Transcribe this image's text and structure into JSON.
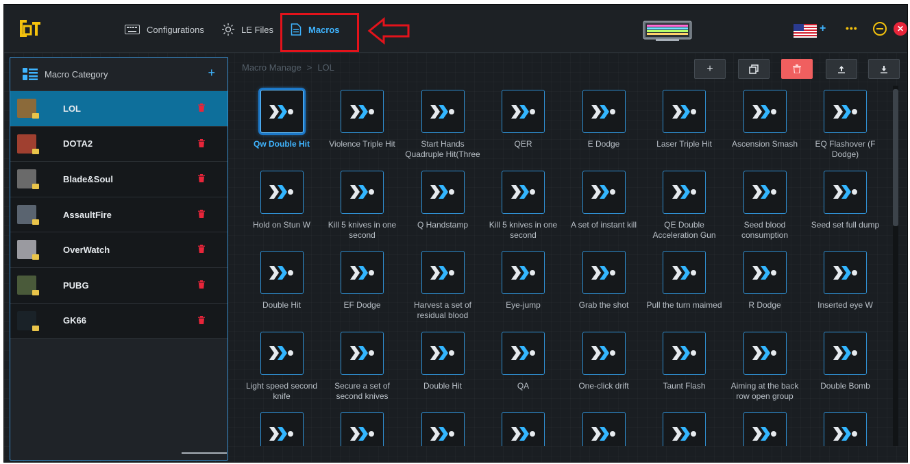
{
  "nav": {
    "configurations": "Configurations",
    "le_files": "LE Files",
    "macros": "Macros"
  },
  "sidebar": {
    "title": "Macro Category",
    "add_icon": "+",
    "items": [
      {
        "label": "LOL",
        "active": true
      },
      {
        "label": "DOTA2",
        "active": false
      },
      {
        "label": "Blade&Soul",
        "active": false
      },
      {
        "label": "AssaultFire",
        "active": false
      },
      {
        "label": "OverWatch",
        "active": false
      },
      {
        "label": "PUBG",
        "active": false
      },
      {
        "label": "GK66",
        "active": false
      }
    ]
  },
  "breadcrumb": {
    "root": "Macro Manage",
    "separator": ">",
    "current": "LOL"
  },
  "toolbar": {
    "add": "+",
    "copy": "copy-icon",
    "delete": "trash-icon",
    "upload": "upload-icon",
    "download": "download-icon"
  },
  "macros": [
    {
      "label": "Qw Double Hit",
      "selected": true
    },
    {
      "label": "Violence Triple Hit"
    },
    {
      "label": "Start Hands Quadruple Hit(Three"
    },
    {
      "label": "QER"
    },
    {
      "label": "E Dodge"
    },
    {
      "label": "Laser Triple Hit"
    },
    {
      "label": "Ascension Smash"
    },
    {
      "label": "EQ Flashover (F Dodge)"
    },
    {
      "label": "Hold on Stun W"
    },
    {
      "label": "Kill 5 knives in one second"
    },
    {
      "label": "Q Handstamp"
    },
    {
      "label": "Kill 5 knives in one second"
    },
    {
      "label": "A set of instant kill"
    },
    {
      "label": "QE Double Acceleration Gun"
    },
    {
      "label": "Seed blood consumption"
    },
    {
      "label": "Seed set full dump"
    },
    {
      "label": "Double Hit"
    },
    {
      "label": "EF Dodge"
    },
    {
      "label": "Harvest a set of residual blood"
    },
    {
      "label": "Eye-jump"
    },
    {
      "label": "Grab the shot"
    },
    {
      "label": "Pull the turn maimed"
    },
    {
      "label": "R Dodge"
    },
    {
      "label": "Inserted eye W"
    },
    {
      "label": "Light speed second knife"
    },
    {
      "label": "Secure a set of second knives"
    },
    {
      "label": "Double Hit"
    },
    {
      "label": "QA"
    },
    {
      "label": "One-click drift"
    },
    {
      "label": "Taunt Flash"
    },
    {
      "label": "Aiming at the back row open group"
    },
    {
      "label": "Double Bomb"
    },
    {
      "label": ""
    },
    {
      "label": ""
    },
    {
      "label": ""
    },
    {
      "label": ""
    },
    {
      "label": ""
    },
    {
      "label": ""
    },
    {
      "label": ""
    },
    {
      "label": ""
    }
  ],
  "colors": {
    "accent": "#3fb4ff",
    "active_row": "#0e6f9b",
    "delete_red": "#e8253a",
    "annotation_red": "#e3131b",
    "logo_yellow": "#f4c20d"
  },
  "icons": {
    "logo": "brand-logo-icon",
    "keyboard": "keyboard-icon",
    "le": "sun-icon",
    "macros": "document-icon",
    "macro_tile": "macro-icon",
    "sidebar_delete": "trash-icon"
  }
}
